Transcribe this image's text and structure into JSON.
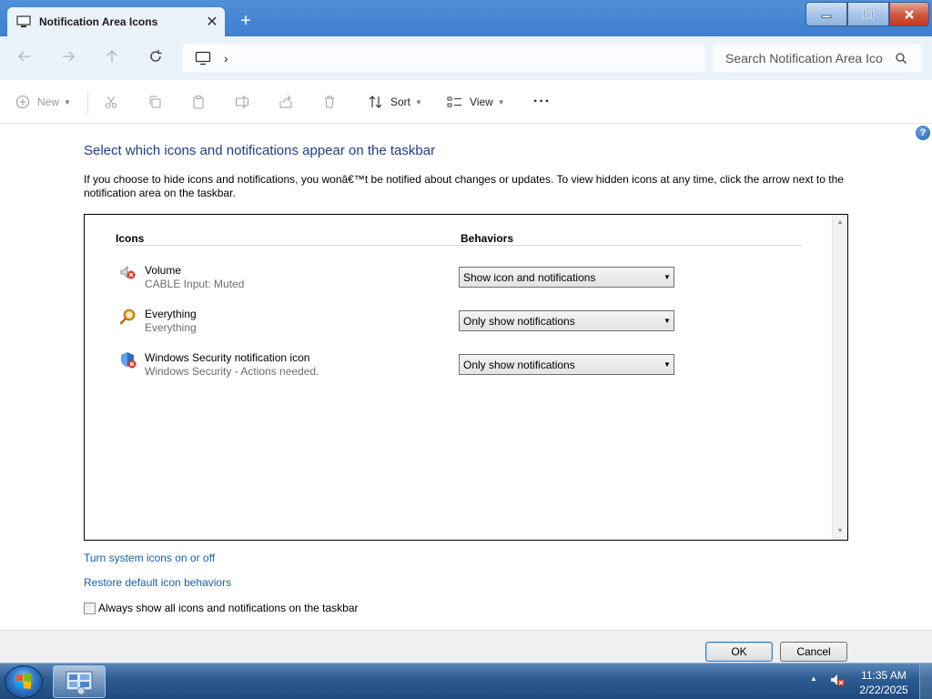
{
  "window": {
    "tab_title": "Notification Area Icons",
    "new_tab": "+",
    "close_tab": "✕"
  },
  "address": {
    "crumb": "›",
    "search_placeholder": "Search Notification Area Ico"
  },
  "toolbar": {
    "new_label": "New",
    "sort_label": "Sort",
    "view_label": "View",
    "more_label": "···"
  },
  "main": {
    "heading": "Select which icons and notifications appear on the taskbar",
    "description": "If you choose to hide icons and notifications, you wonâ€™t be notified about changes or updates. To view hidden icons at any time, click the arrow next to the notification area on the taskbar.",
    "col_icons": "Icons",
    "col_behaviors": "Behaviors",
    "rows": [
      {
        "name": "Volume",
        "subtitle": "CABLE Input: Muted",
        "behavior": "Show icon and notifications",
        "icon": "volume-muted-icon"
      },
      {
        "name": "Everything",
        "subtitle": "Everything",
        "behavior": "Only show notifications",
        "icon": "everything-search-icon"
      },
      {
        "name": "Windows Security notification icon",
        "subtitle": "Windows Security - Actions needed.",
        "behavior": "Only show notifications",
        "icon": "windows-security-icon"
      }
    ],
    "link_system_icons": "Turn system icons on or off",
    "link_restore": "Restore default icon behaviors",
    "always_show_label": "Always show all icons and notifications on the taskbar",
    "always_show_checked": false
  },
  "footer": {
    "ok_label": "OK",
    "cancel_label": "Cancel"
  },
  "taskbar": {
    "time": "11:35 AM",
    "date": "2/22/2025"
  },
  "colors": {
    "heading": "#1e3f8a",
    "link": "#1a5ea8",
    "titlebar": "#4f8fd6"
  }
}
